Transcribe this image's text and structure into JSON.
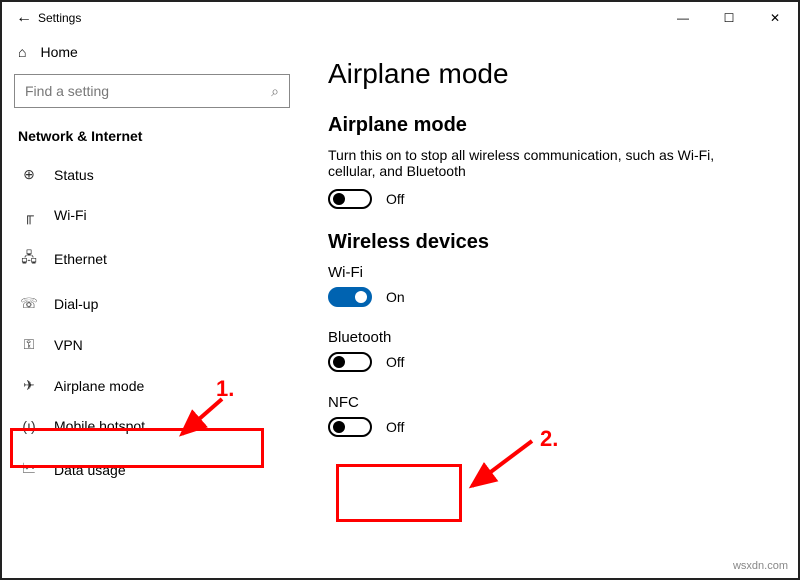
{
  "window": {
    "title": "Settings",
    "controls": {
      "min": "—",
      "max": "☐",
      "close": "✕"
    }
  },
  "sidebar": {
    "home": "Home",
    "search_placeholder": "Find a setting",
    "category": "Network & Internet",
    "items": [
      {
        "icon": "⊕",
        "label": "Status"
      },
      {
        "icon": "╓",
        "label": "Wi-Fi"
      },
      {
        "icon": "🖧",
        "label": "Ethernet"
      },
      {
        "icon": "☏",
        "label": "Dial-up"
      },
      {
        "icon": "⚿",
        "label": "VPN"
      },
      {
        "icon": "✈",
        "label": "Airplane mode"
      },
      {
        "icon": "(ı)",
        "label": "Mobile hotspot"
      },
      {
        "icon": "🗠",
        "label": "Data usage"
      }
    ]
  },
  "content": {
    "title": "Airplane mode",
    "section1": {
      "heading": "Airplane mode",
      "desc": "Turn this on to stop all wireless communication, such as Wi-Fi, cellular, and Bluetooth",
      "state": "Off"
    },
    "section2": {
      "heading": "Wireless devices",
      "wifi": {
        "label": "Wi-Fi",
        "state": "On"
      },
      "bluetooth": {
        "label": "Bluetooth",
        "state": "Off"
      },
      "nfc": {
        "label": "NFC",
        "state": "Off"
      }
    }
  },
  "annotations": {
    "one": "1.",
    "two": "2.",
    "watermark": "wsxdn.com"
  }
}
